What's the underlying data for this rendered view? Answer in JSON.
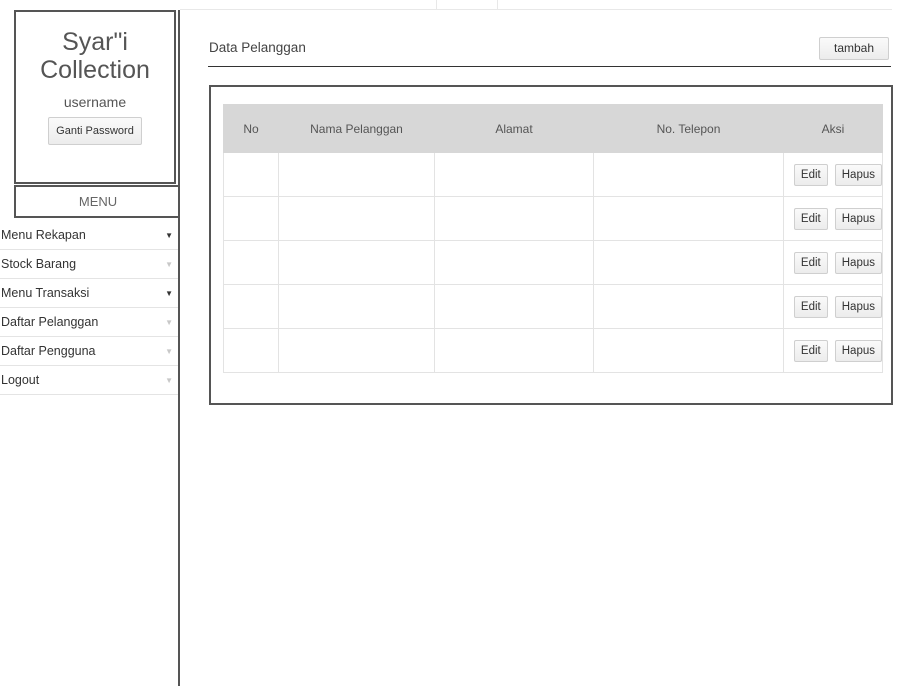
{
  "sidebar": {
    "brand_line1": "Syar\"i",
    "brand_line2": "Collection",
    "username": "username",
    "ganti_password": "Ganti Password",
    "menu_heading": "MENU",
    "items": [
      {
        "label": "Menu Rekapan",
        "caret": "▼"
      },
      {
        "label": "Stock Barang",
        "caret": "▼"
      },
      {
        "label": "Menu Transaksi",
        "caret": "▼"
      },
      {
        "label": "Daftar Pelanggan",
        "caret": "▼"
      },
      {
        "label": "Daftar Pengguna",
        "caret": "▼"
      },
      {
        "label": "Logout",
        "caret": "▼"
      }
    ]
  },
  "main": {
    "title": "Data Pelanggan",
    "add_button": "tambah",
    "table": {
      "headers": [
        "No",
        "Nama Pelanggan",
        "Alamat",
        "No. Telepon",
        "Aksi"
      ],
      "rows": [
        {
          "edit": "Edit",
          "hapus": "Hapus"
        },
        {
          "edit": "Edit",
          "hapus": "Hapus"
        },
        {
          "edit": "Edit",
          "hapus": "Hapus"
        },
        {
          "edit": "Edit",
          "hapus": "Hapus"
        },
        {
          "edit": "Edit",
          "hapus": "Hapus"
        }
      ]
    }
  }
}
